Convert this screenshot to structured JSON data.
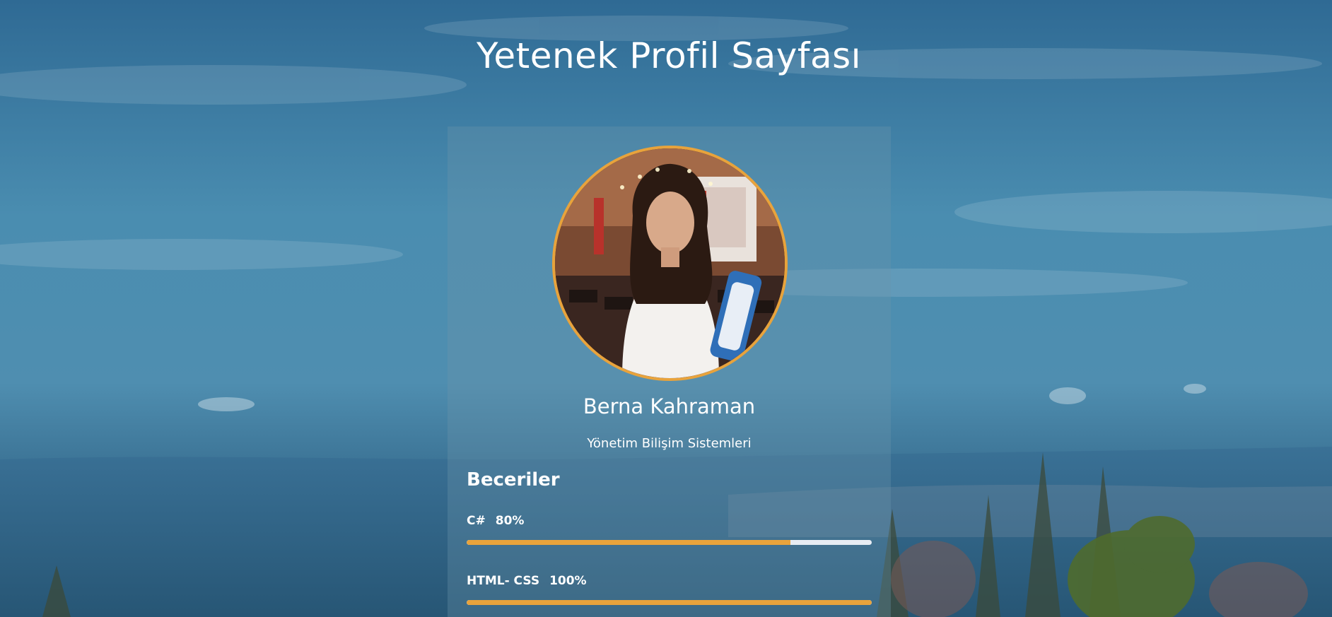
{
  "page": {
    "title": "Yetenek Profil Sayfası"
  },
  "profile": {
    "name": "Berna Kahraman",
    "department": "Yönetim Bilişim Sistemleri",
    "avatar_icon": "profile-photo",
    "accent_color": "#e8a33c"
  },
  "skills": {
    "heading": "Beceriler",
    "items": [
      {
        "label": "C#",
        "percent_text": "80%",
        "value": 0.8
      },
      {
        "label": "HTML- CSS",
        "percent_text": "100%",
        "value": 1.0
      }
    ]
  }
}
